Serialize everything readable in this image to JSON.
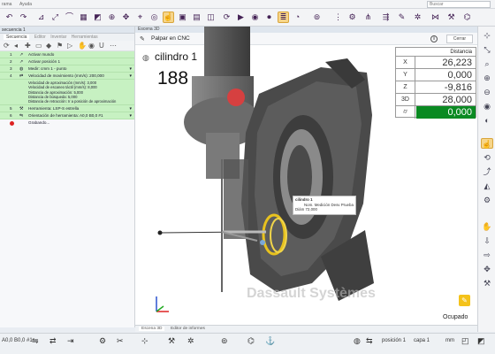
{
  "menubar": {
    "items": [
      "rama",
      "Ayuda"
    ],
    "search_value": "Buscar"
  },
  "toolbar_icons": [
    "undo-icon",
    "redo-icon",
    "measure-icon",
    "fit-icon",
    "edge-icon",
    "grid-icon",
    "select-icon",
    "reference-icon",
    "move-icon",
    "camera-icon",
    "circle-icon",
    "play-icon",
    "record-icon",
    "report-icon",
    "gauge-icon",
    "image-icon",
    "target-icon",
    "network-icon",
    "robot-icon",
    "layers-icon",
    "arrows-icon",
    "gear-icon"
  ],
  "left_panel": {
    "title": "secuencia 1",
    "tabs": [
      "Secuencia",
      "Editor",
      "Inventar",
      "Herramientas"
    ],
    "rows": [
      {
        "num": "1",
        "icon": "↗",
        "label": "Activar mundo"
      },
      {
        "num": "2",
        "icon": "↗",
        "label": "Activar posición 1"
      },
      {
        "num": "3",
        "icon": "◍",
        "label": "Medir: cmm 1 - punto"
      },
      {
        "num": "4",
        "icon": "⇄",
        "label": "Velocidad de movimiento (mm/s): 200,000"
      }
    ],
    "details": [
      "Velocidad de aproximación (mm/s): 3,000",
      "Velocidad de escaneo táctil (mm/s): 8,000",
      "Distancia de aproximación: 5,000",
      "Distancia de búsqueda: 5,000",
      "Distancia de retracción: Ir a posición de aproximación"
    ],
    "rows2": [
      {
        "num": "5",
        "icon": "⚒",
        "label": "Herramienta: LSP-S estrella"
      },
      {
        "num": "6",
        "icon": "⇋",
        "label": "Orientación de herramienta: A0,0 B0,0 #1"
      }
    ],
    "recording": "Grabando..."
  },
  "scene": {
    "tab": "Escena 3D",
    "header_title": "Palpar en CNC",
    "info_icon": "i",
    "close_button": "Cerrar",
    "feature_name": "cilindro 1",
    "feature_value": "188",
    "distance_table": {
      "header": "Distancia",
      "rows": [
        {
          "label": "X",
          "value": "26,223"
        },
        {
          "label": "Y",
          "value": "0,000"
        },
        {
          "label": "Z",
          "value": "-9,816"
        },
        {
          "label": "3D",
          "value": "28,000"
        },
        {
          "label": "⌭",
          "value": "0,000"
        }
      ]
    },
    "callout": {
      "title": "cilindro 1",
      "cols": "Nom.  Medición  Desv  Prueba",
      "row": "Diám  72,000"
    },
    "watermark": "Dassault Systèmes",
    "status": "Ocupado",
    "status_color": "#f4c21a",
    "tolerance_color": "#0a8a22"
  },
  "bottom_tabs": [
    "Escena 3D",
    "Editor de informes"
  ],
  "statusbar": {
    "left": "A0,0 B0,0 #1",
    "pos_label": "posición 1",
    "layer_label": "capa 1",
    "unit_label": "mm"
  }
}
